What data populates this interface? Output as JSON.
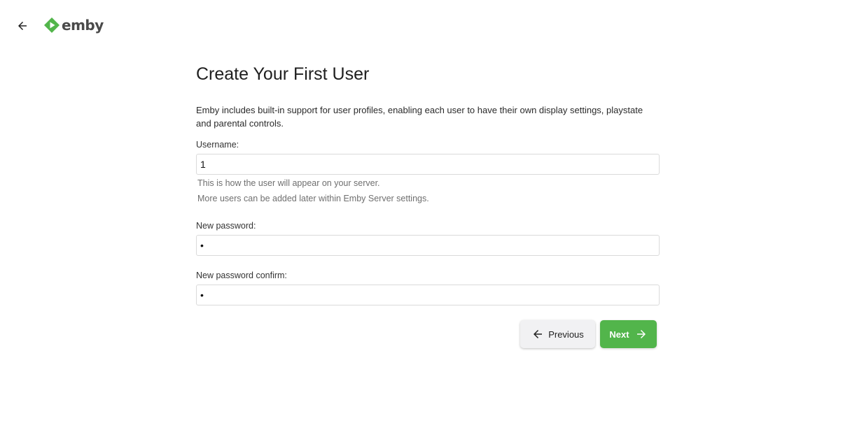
{
  "header": {
    "back_icon": "arrow-left-icon",
    "logo_text": "emby",
    "logo_color": "#52b54b"
  },
  "wizard": {
    "title": "Create Your First User",
    "intro": "Emby includes built-in support for user profiles, enabling each user to have their own display settings, playstate and parental controls.",
    "username": {
      "label": "Username:",
      "value": "1",
      "help_1": "This is how the user will appear on your server.",
      "help_2": "More users can be added later within Emby Server settings."
    },
    "password": {
      "label": "New password:",
      "value": "1"
    },
    "password_confirm": {
      "label": "New password confirm:",
      "value": "1"
    },
    "buttons": {
      "previous_label": "Previous",
      "previous_icon": "arrow-left-icon",
      "next_label": "Next",
      "next_icon": "arrow-right-icon"
    }
  }
}
